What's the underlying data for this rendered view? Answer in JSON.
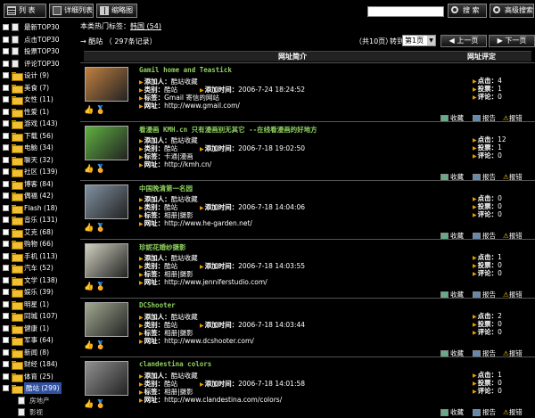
{
  "toolbar": {
    "list_label": "列 表",
    "detail_label": "详细列表",
    "thumb_label": "缩略图",
    "search_label": "搜 索",
    "adv_search_label": "高级搜索"
  },
  "sidebar": {
    "items": [
      {
        "label": "最新TOP30",
        "type": "page"
      },
      {
        "label": "点击TOP30",
        "type": "page"
      },
      {
        "label": "投票TOP30",
        "type": "page"
      },
      {
        "label": "评论TOP30",
        "type": "page"
      },
      {
        "label": "设计 (9)",
        "type": "folder"
      },
      {
        "label": "美食 (7)",
        "type": "folder"
      },
      {
        "label": "女性 (11)",
        "type": "folder"
      },
      {
        "label": "性爱 (1)",
        "type": "folder"
      },
      {
        "label": "游戏 (143)",
        "type": "folder"
      },
      {
        "label": "下载 (56)",
        "type": "folder"
      },
      {
        "label": "电脑 (34)",
        "type": "folder"
      },
      {
        "label": "聊天 (32)",
        "type": "folder"
      },
      {
        "label": "社区 (139)",
        "type": "folder"
      },
      {
        "label": "博客 (84)",
        "type": "folder"
      },
      {
        "label": "偶福 (42)",
        "type": "folder"
      },
      {
        "label": "Flash (18)",
        "type": "folder"
      },
      {
        "label": "音乐 (131)",
        "type": "folder"
      },
      {
        "label": "艾克 (68)",
        "type": "folder"
      },
      {
        "label": "购物 (66)",
        "type": "folder"
      },
      {
        "label": "手机 (113)",
        "type": "folder"
      },
      {
        "label": "汽车 (52)",
        "type": "folder"
      },
      {
        "label": "文学 (138)",
        "type": "folder"
      },
      {
        "label": "娱乐 (39)",
        "type": "folder"
      },
      {
        "label": "明星 (1)",
        "type": "folder"
      },
      {
        "label": "同城 (107)",
        "type": "folder"
      },
      {
        "label": "健康 (1)",
        "type": "folder"
      },
      {
        "label": "军事 (64)",
        "type": "folder"
      },
      {
        "label": "新闻 (8)",
        "type": "folder"
      },
      {
        "label": "财经 (184)",
        "type": "folder"
      },
      {
        "label": "体育 (25)",
        "type": "folder"
      },
      {
        "label": "酷站 (299)",
        "type": "folder",
        "selected": true
      },
      {
        "label": "房地产",
        "type": "sub"
      },
      {
        "label": "影视",
        "type": "sub"
      }
    ]
  },
  "header": {
    "hot_tags_prefix": "本类热门标签：",
    "hot_tag": "韩国 (54)",
    "crumb_arrow": "→ 酷站",
    "record_count": "（ 297条记录）",
    "page_info": "（共10页）",
    "goto_label": "转到",
    "page_select": "第1页",
    "prev_label": "上一页",
    "next_label": "下一页"
  },
  "columns": {
    "desc": "网址简介",
    "rating": "网址评定"
  },
  "labels": {
    "added_by": "添加人：",
    "category": "类别：",
    "added_time": "添加时间：",
    "tags": "标签：",
    "url": "网址：",
    "clicks": "点击：",
    "votes": "投票：",
    "comments": "评论：",
    "fav": "收藏",
    "report": "报告",
    "rate": "报错"
  },
  "entries": [
    {
      "title": "Gamil home and Teastick",
      "added_by": "酷站收藏",
      "category": "酷站",
      "time": "2006-7-24 18:24:52",
      "tags": "Gmail 寄信的网站",
      "url": "http://www.gmail.com/",
      "clicks": "4",
      "votes": "1",
      "comments": "0",
      "thumb_color": "#c08040"
    },
    {
      "title": "看漫画 KMH.cn 只有漫画别无其它 --在线看漫画的好地方",
      "added_by": "酷站收藏",
      "category": "酷站",
      "time": "2006-7-18 19:02:50",
      "tags": "卡通|漫画",
      "url": "http://kmh.cn/",
      "clicks": "12",
      "votes": "1",
      "comments": "0",
      "thumb_color": "#60b040"
    },
    {
      "title": "中国晚清第一名园",
      "added_by": "酷站收藏",
      "category": "酷站",
      "time": "2006-7-18 14:04:06",
      "tags": "相册|摄影",
      "url": "http://www.he-garden.net/",
      "clicks": "0",
      "votes": "0",
      "comments": "0",
      "thumb_color": "#8090a0"
    },
    {
      "title": "珍妮花婚纱摄影",
      "added_by": "酷站收藏",
      "category": "酷站",
      "time": "2006-7-18 14:03:55",
      "tags": "相册|摄影",
      "url": "http://www.jenniferstudio.com/",
      "clicks": "1",
      "votes": "0",
      "comments": "0",
      "thumb_color": "#d0d0c0"
    },
    {
      "title": "DCShooter",
      "added_by": "酷站收藏",
      "category": "酷站",
      "time": "2006-7-18 14:03:44",
      "tags": "相册|摄影",
      "url": "http://www.dcshooter.com/",
      "clicks": "2",
      "votes": "0",
      "comments": "0",
      "thumb_color": "#a0a890"
    },
    {
      "title": "clandestina colors",
      "added_by": "酷站收藏",
      "category": "酷站",
      "time": "2006-7-18 14:01:58",
      "tags": "相册|摄影",
      "url": "http://www.clandestina.com/colors/",
      "clicks": "1",
      "votes": "0",
      "comments": "0",
      "thumb_color": "#909090"
    }
  ]
}
